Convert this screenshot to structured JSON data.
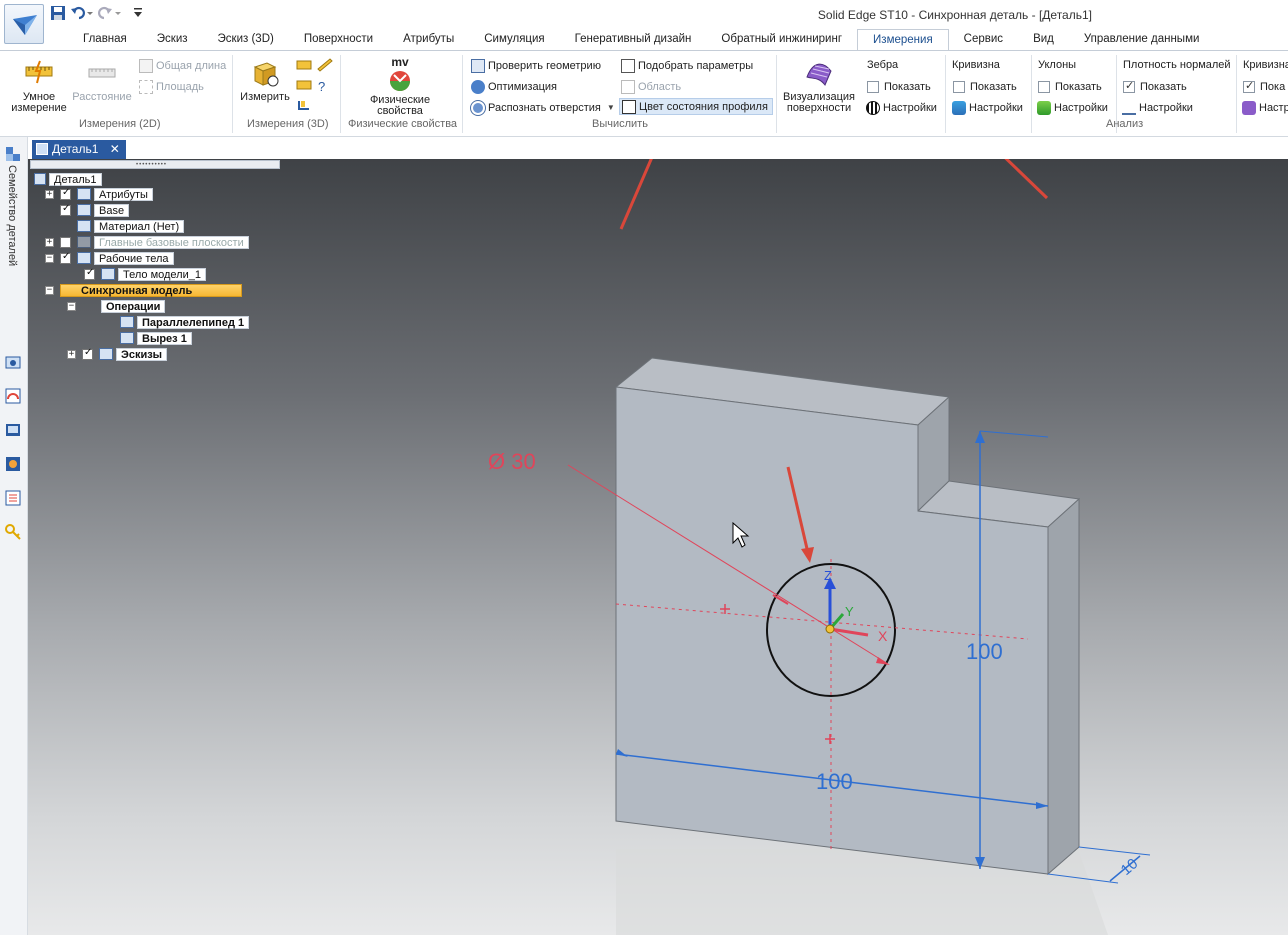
{
  "window": {
    "title": "Solid Edge ST10 - Синхронная деталь - [Деталь1]"
  },
  "tabs": [
    {
      "label": "Главная"
    },
    {
      "label": "Эскиз"
    },
    {
      "label": "Эскиз (3D)"
    },
    {
      "label": "Поверхности"
    },
    {
      "label": "Атрибуты"
    },
    {
      "label": "Симуляция"
    },
    {
      "label": "Генеративный дизайн"
    },
    {
      "label": "Обратный инжиниринг"
    },
    {
      "label": "Измерения",
      "active": true
    },
    {
      "label": "Сервис"
    },
    {
      "label": "Вид"
    },
    {
      "label": "Управление данными"
    }
  ],
  "ribbon": {
    "measure2d": {
      "smart_measure": "Умное измерение",
      "distance": "Расстояние",
      "total_length": "Общая длина",
      "area": "Площадь",
      "group_label": "Измерения (2D)"
    },
    "measure3d": {
      "measure": "Измерить",
      "group_label": "Измерения (3D)"
    },
    "physprops": {
      "icon_text": "mv",
      "button": "Физические свойства",
      "group_label": "Физические свойства"
    },
    "compute": {
      "check_geometry": "Проверить геометрию",
      "optimization": "Оптимизация",
      "recognize_holes": "Распознать отверстия",
      "fit_params": "Подобрать параметры",
      "region": "Область",
      "profile_status_color": "Цвет состояния профиля",
      "group_label": "Вычислить"
    },
    "analysis": {
      "surface_viz": "Визуализация поверхности",
      "zebra": {
        "head": "Зебра",
        "show": "Показать",
        "settings": "Настройки",
        "checked": false
      },
      "curvature": {
        "head": "Кривизна",
        "show": "Показать",
        "settings": "Настройки",
        "checked": false
      },
      "slopes": {
        "head": "Уклоны",
        "show": "Показать",
        "settings": "Настройки",
        "checked": false
      },
      "normal_density": {
        "head": "Плотность нормалей",
        "show": "Показать",
        "settings": "Настройки",
        "checked": true
      },
      "curvature2": {
        "head": "Кривизна",
        "show": "Пока",
        "settings": "Настр",
        "checked": true
      },
      "group_label": "Анализ"
    }
  },
  "left_strip": {
    "label": "Семейство деталей"
  },
  "document_tab": {
    "label": "Деталь1"
  },
  "tree": {
    "root": "Деталь1",
    "items": [
      {
        "label": "Атрибуты"
      },
      {
        "label": "Base"
      },
      {
        "label": "Материал (Нет)"
      },
      {
        "label": "Главные базовые плоскости"
      },
      {
        "label": "Рабочие тела"
      },
      {
        "label": "Тело модели_1"
      },
      {
        "label": "Синхронная модель"
      },
      {
        "label": "Операции"
      },
      {
        "label": "Параллелепипед 1"
      },
      {
        "label": "Вырез 1"
      },
      {
        "label": "Эскизы"
      }
    ]
  },
  "model": {
    "diameter_label": "Ø 30",
    "dim_height": "100",
    "dim_width": "100",
    "dim_depth": "10",
    "axis_x": "X",
    "axis_y": "Y",
    "axis_z": "Z"
  },
  "colors": {
    "accent": "#1c4f8f",
    "annotation_red": "#e0455a",
    "dimension_blue": "#2f6fd1",
    "arrow_red": "#d9473a"
  }
}
